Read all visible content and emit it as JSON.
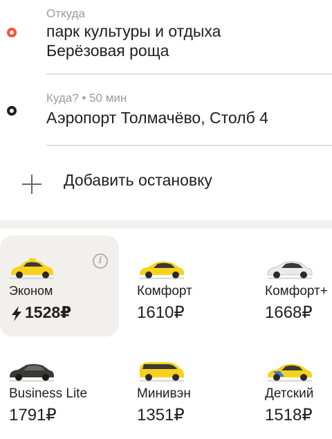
{
  "route": {
    "from": {
      "caption": "Откуда",
      "address_line1": "парк культуры и отдыха",
      "address_line2": "Берёзовая роща"
    },
    "to": {
      "caption": "Куда? • 50 мин",
      "address": "Аэропорт Толмачёво, Столб 4"
    },
    "add_stop_label": "Добавить остановку"
  },
  "tariffs": [
    {
      "name": "Эконом",
      "price": "1528₽",
      "selected": true,
      "car_color": "#f7d21a",
      "icon": "economy-car-icon"
    },
    {
      "name": "Комфорт",
      "price": "1610₽",
      "selected": false,
      "car_color": "#f7d21a",
      "icon": "comfort-car-icon"
    },
    {
      "name": "Комфорт+",
      "price": "1668₽",
      "selected": false,
      "car_color": "#ebeae8",
      "icon": "comfort-plus-car-icon"
    },
    {
      "name": "Business Lite",
      "price": "1791₽",
      "selected": false,
      "car_color": "#3a3938",
      "icon": "business-car-icon"
    },
    {
      "name": "Минивэн",
      "price": "1351₽",
      "selected": false,
      "car_color": "#f7d21a",
      "icon": "minivan-car-icon"
    },
    {
      "name": "Детский",
      "price": "1518₽",
      "selected": false,
      "car_color": "#f7d21a",
      "icon": "child-car-icon"
    }
  ],
  "colors": {
    "from_dot": "#fc5230",
    "to_dot": "#21201f",
    "selected_bg": "#f2f0ed",
    "taxi_yellow": "#f7d21a"
  }
}
